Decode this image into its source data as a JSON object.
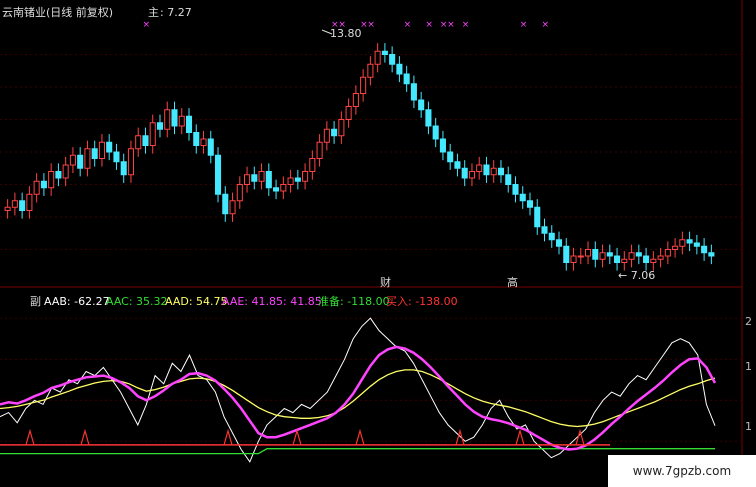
{
  "header": {
    "title": "云南锗业(日线 前复权)",
    "main_label": "主",
    "main_value": ": 7.27"
  },
  "annotations": {
    "high_label": "13.80",
    "low_label": "← 7.06",
    "markers": [
      "财",
      "高"
    ]
  },
  "indicator": {
    "prefix": "副",
    "labels": [
      {
        "text": "AAB: -62.27",
        "color": "#ffffff"
      },
      {
        "text": "AAC: 35.32",
        "color": "#33dd33"
      },
      {
        "text": "AAD: 54.75",
        "color": "#ffff66"
      },
      {
        "text": "AAE: 41.85",
        "color": "#ff44ff"
      },
      {
        "text": ": 41.85",
        "color": "#ff44ff"
      },
      {
        "text": "准备: -118.00",
        "color": "#33dd33"
      },
      {
        "text": "买入: -138.00",
        "color": "#ff3333"
      }
    ],
    "axis_ticks": [
      "2",
      "1",
      "1"
    ]
  },
  "watermark": "www.7gpzb.com",
  "chart_data": [
    {
      "type": "candlestick",
      "title": "云南锗业(日线 前复权)",
      "close": [
        8.8,
        9.0,
        8.7,
        9.2,
        9.6,
        9.4,
        9.9,
        9.7,
        10.1,
        10.4,
        10.0,
        10.6,
        10.3,
        10.8,
        10.5,
        10.2,
        9.8,
        10.6,
        11.0,
        10.7,
        11.4,
        11.2,
        11.8,
        11.3,
        11.6,
        11.1,
        10.7,
        10.9,
        10.4,
        9.2,
        8.6,
        9.0,
        9.5,
        9.8,
        9.6,
        9.9,
        9.4,
        9.3,
        9.5,
        9.7,
        9.6,
        9.9,
        10.3,
        10.8,
        11.2,
        11.0,
        11.5,
        11.9,
        12.3,
        12.8,
        13.2,
        13.6,
        13.5,
        13.2,
        12.9,
        12.6,
        12.1,
        11.8,
        11.3,
        10.9,
        10.5,
        10.2,
        10.0,
        9.7,
        9.9,
        10.1,
        9.8,
        10.0,
        9.8,
        9.5,
        9.2,
        9.0,
        8.8,
        8.2,
        8.0,
        7.8,
        7.6,
        7.1,
        7.3,
        7.3,
        7.5,
        7.2,
        7.4,
        7.3,
        7.1,
        7.2,
        7.4,
        7.3,
        7.1,
        7.2,
        7.3,
        7.5,
        7.6,
        7.8,
        7.7,
        7.6,
        7.4,
        7.3
      ],
      "markers_x": [
        19,
        45,
        46,
        49,
        50,
        55,
        58,
        60,
        61,
        63,
        71,
        74
      ],
      "high": 13.8,
      "low": 7.06,
      "ylim": [
        6.5,
        14.5
      ]
    },
    {
      "type": "line",
      "series": [
        {
          "name": "AAB",
          "color": "#ffffff",
          "values": [
            -40,
            -30,
            -55,
            -20,
            0,
            -10,
            30,
            20,
            50,
            40,
            70,
            60,
            80,
            50,
            20,
            -20,
            -60,
            -10,
            60,
            40,
            90,
            70,
            110,
            60,
            50,
            20,
            -40,
            -80,
            -120,
            -150,
            -100,
            -60,
            -40,
            -20,
            -30,
            -10,
            -20,
            0,
            20,
            60,
            100,
            150,
            180,
            200,
            170,
            150,
            130,
            120,
            90,
            50,
            10,
            -30,
            -60,
            -80,
            -100,
            -90,
            -60,
            -20,
            0,
            -40,
            -70,
            -60,
            -100,
            -120,
            -140,
            -130,
            -110,
            -90,
            -70,
            -30,
            0,
            20,
            10,
            40,
            60,
            50,
            80,
            110,
            140,
            150,
            140,
            110,
            -10,
            -62
          ]
        },
        {
          "name": "AAC",
          "color": "#33dd33",
          "values": [
            -130,
            -130,
            -130,
            -130,
            -130,
            -130,
            -130,
            -130,
            -130,
            -130,
            -130,
            -130,
            -130,
            -130,
            -130,
            -130,
            -130,
            -130,
            -130,
            -130,
            -130,
            -130,
            -130,
            -130,
            -130,
            -130,
            -130,
            -130,
            -130,
            -130,
            -130,
            -118,
            -118,
            -118,
            -118,
            -118,
            -118,
            -118,
            -118,
            -118,
            -118,
            -118,
            -118,
            -118,
            -118,
            -118,
            -118,
            -118,
            -118,
            -118,
            -118,
            -118,
            -118,
            -118,
            -118,
            -118,
            -118,
            -118,
            -118,
            -118,
            -118,
            -118,
            -118,
            -118,
            -118,
            -118,
            -118,
            -118,
            -118,
            -118,
            -118,
            -118,
            -118,
            -118,
            -118,
            -118,
            -118,
            -118,
            -118,
            -118,
            -118,
            -118,
            -118,
            -118
          ]
        },
        {
          "name": "AAD",
          "color": "#ffff66",
          "values": [
            -20,
            -18,
            -15,
            -10,
            -5,
            0,
            8,
            15,
            22,
            30,
            36,
            42,
            46,
            48,
            46,
            40,
            30,
            22,
            26,
            32,
            40,
            46,
            52,
            54,
            52,
            46,
            36,
            24,
            10,
            -4,
            -18,
            -28,
            -36,
            -40,
            -42,
            -44,
            -44,
            -42,
            -38,
            -30,
            -18,
            -2,
            16,
            34,
            50,
            62,
            70,
            74,
            74,
            70,
            62,
            52,
            40,
            28,
            16,
            6,
            -2,
            -8,
            -12,
            -16,
            -22,
            -28,
            -36,
            -44,
            -52,
            -58,
            -62,
            -64,
            -62,
            -58,
            -52,
            -44,
            -36,
            -28,
            -20,
            -12,
            -4,
            6,
            16,
            26,
            34,
            40,
            48,
            54
          ]
        },
        {
          "name": "AAE",
          "color": "#ff44ff",
          "values": [
            -10,
            -5,
            -8,
            0,
            10,
            18,
            30,
            36,
            44,
            50,
            56,
            58,
            60,
            54,
            44,
            30,
            10,
            0,
            10,
            24,
            40,
            50,
            64,
            66,
            60,
            48,
            28,
            6,
            -20,
            -50,
            -80,
            -90,
            -90,
            -84,
            -76,
            -68,
            -60,
            -52,
            -44,
            -30,
            -10,
            16,
            50,
            84,
            110,
            124,
            130,
            126,
            116,
            100,
            80,
            58,
            34,
            12,
            -10,
            -28,
            -40,
            -46,
            -50,
            -56,
            -64,
            -72,
            -84,
            -96,
            -108,
            -116,
            -120,
            -118,
            -110,
            -96,
            -78,
            -58,
            -40,
            -20,
            -2,
            14,
            30,
            48,
            68,
            86,
            100,
            102,
            80,
            42
          ]
        },
        {
          "name": "准备",
          "color": "#33dd33",
          "values": [
            -118
          ]
        },
        {
          "name": "买入",
          "color": "#ff3333",
          "values": [
            -138
          ]
        }
      ]
    }
  ]
}
